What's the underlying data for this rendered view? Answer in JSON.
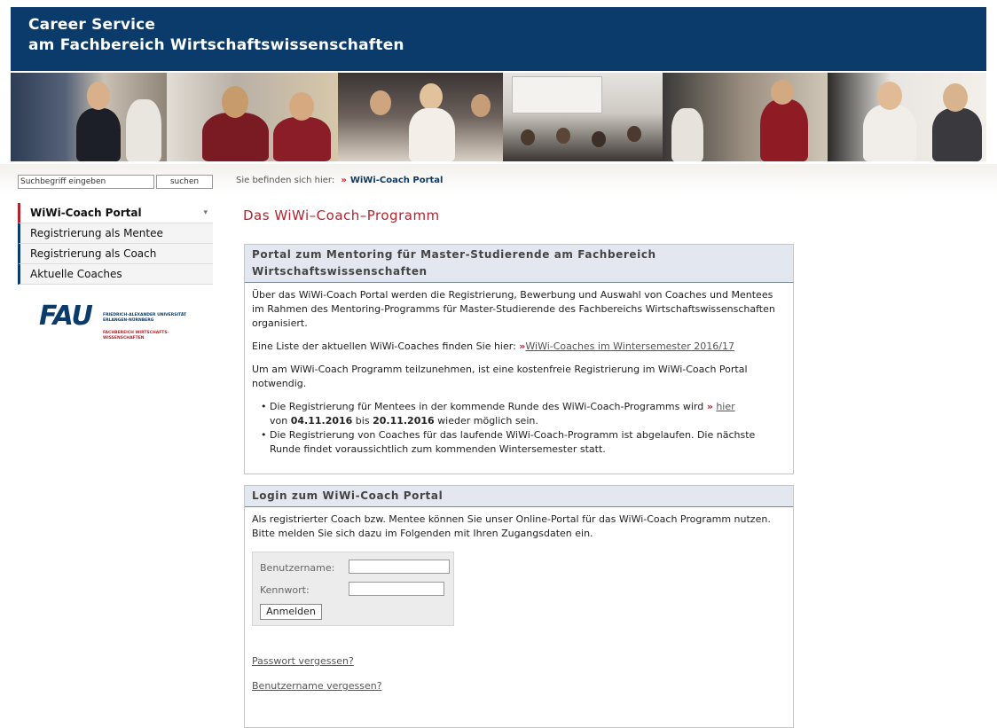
{
  "header": {
    "line1": "Career Service",
    "line2": "am Fachbereich Wirtschaftswissenschaften"
  },
  "colors": {
    "brand_blue": "#0a3b6b",
    "accent_red": "#b4232d"
  },
  "search": {
    "placeholder": "Suchbegriff eingeben",
    "button": "suchen"
  },
  "breadcrumb": {
    "prefix": "Sie befinden sich hier:",
    "arrow": "»",
    "current": "WiWi-Coach Portal"
  },
  "sidebar": {
    "items": [
      {
        "label": "WiWi-Coach Portal"
      },
      {
        "label": "Registrierung als Mentee"
      },
      {
        "label": "Registrierung als Coach"
      },
      {
        "label": "Aktuelle Coaches"
      }
    ],
    "chevron": "▾"
  },
  "logo": {
    "mark": "FAU",
    "line1": "FRIEDRICH-ALEXANDER UNIVERSITÄT ERLANGEN-NÜRNBERG",
    "line2": "FACHBEREICH WIRTSCHAFTS-WISSENSCHAFTEN"
  },
  "page": {
    "title": "Das WiWi–Coach–Programm"
  },
  "box1": {
    "heading": "Portal zum Mentoring für Master-Studierende am Fachbereich Wirtschaftswissenschaften",
    "p1": "Über das WiWi-Coach Portal werden die Registrierung, Bewerbung und Auswahl von Coaches und Mentees im Rahmen des Mentoring-Programms für Master-Studierende des Fachbereichs Wirtschaftswissenschaften organisiert.",
    "p2_text": "Eine Liste der aktuellen WiWi-Coaches finden Sie hier: ",
    "p2_arrow": "»",
    "p2_link": "WiWi-Coaches im Wintersemester 2016/17",
    "p3": "Um am WiWi-Coach Programm teilzunehmen, ist eine kostenfreie Registrierung im WiWi-Coach Portal notwendig.",
    "b1_a": "Die Registrierung für Mentees in der kommende Runde des WiWi-Coach-Programms wird ",
    "b1_arrow": "»",
    "b1_link": "hier",
    "b1_b": "von ",
    "b1_date1": "04.11.2016",
    "b1_c": " bis ",
    "b1_date2": "20.11.2016",
    "b1_d": " wieder möglich sein.",
    "b2": "Die Registrierung von Coaches für das laufende WiWi-Coach-Programm ist abgelaufen. Die nächste Runde findet voraussichtlich zum kommenden Wintersemester statt."
  },
  "box2": {
    "heading": "Login zum WiWi-Coach Portal",
    "p1": "Als registrierter Coach bzw. Mentee können Sie unser Online-Portal für das WiWi-Coach Programm nutzen.",
    "p2": "Bitte melden Sie sich dazu im Folgenden mit Ihren Zugangsdaten ein.",
    "username_label": "Benutzername:",
    "password_label": "Kennwort:",
    "username_value": "",
    "password_value": "",
    "login_button": "Anmelden",
    "forgot_password": "Passwort vergessen?",
    "forgot_username": "Benutzername vergessen?"
  }
}
